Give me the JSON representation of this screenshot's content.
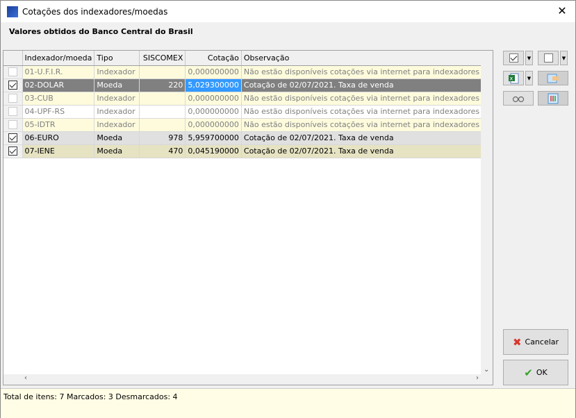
{
  "window": {
    "title": "Cotações dos indexadores/moedas",
    "close": "✕"
  },
  "subtitle": "Valores obtidos do Banco Central do Brasil",
  "table": {
    "columns": [
      "Indexador/moeda",
      "Tipo",
      "SISCOMEX",
      "Cotação",
      "Observação"
    ],
    "rows": [
      {
        "checked": false,
        "name": "01-U.F.I.R.",
        "tipo": "Indexador",
        "siscomex": "",
        "cotacao": "0,000000000",
        "obs": "Não estão disponíveis cotações via internet para indexadores"
      },
      {
        "checked": true,
        "name": "02-DOLAR",
        "tipo": "Moeda",
        "siscomex": "220",
        "cotacao": "5,029300000",
        "obs": "Cotação de 02/07/2021. Taxa de venda"
      },
      {
        "checked": false,
        "name": "03-CUB",
        "tipo": "Indexador",
        "siscomex": "",
        "cotacao": "0,000000000",
        "obs": "Não estão disponíveis cotações via internet para indexadores"
      },
      {
        "checked": false,
        "name": "04-UPF-RS",
        "tipo": "Indexador",
        "siscomex": "",
        "cotacao": "0,000000000",
        "obs": "Não estão disponíveis cotações via internet para indexadores"
      },
      {
        "checked": false,
        "name": "05-IDTR",
        "tipo": "Indexador",
        "siscomex": "",
        "cotacao": "0,000000000",
        "obs": "Não estão disponíveis cotações via internet para indexadores"
      },
      {
        "checked": true,
        "name": "06-EURO",
        "tipo": "Moeda",
        "siscomex": "978",
        "cotacao": "5,959700000",
        "obs": "Cotação de 02/07/2021. Taxa de venda"
      },
      {
        "checked": true,
        "name": "07-IENE",
        "tipo": "Moeda",
        "siscomex": "470",
        "cotacao": "0,045190000",
        "obs": "Cotação de 02/07/2021. Taxa de venda"
      }
    ]
  },
  "buttons": {
    "cancel": "Cancelar",
    "ok": "OK"
  },
  "status": "Total de itens: 7 Marcados: 3 Desmarcados: 4",
  "colors": {
    "selected_row": "#808080",
    "focused_cell": "#3399ff",
    "indexer_row": "#fdfbdc",
    "status_bg": "#fffde6"
  }
}
